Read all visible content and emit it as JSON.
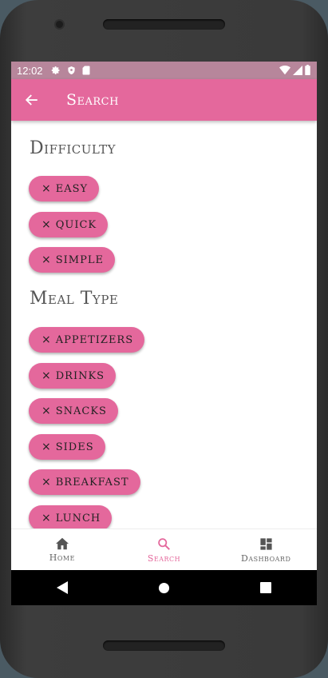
{
  "status": {
    "time": "12:02"
  },
  "appbar": {
    "title": "Search"
  },
  "sections": {
    "difficulty": {
      "title": "Difficulty",
      "chips": [
        "EASY",
        "QUICK",
        "SIMPLE"
      ]
    },
    "meal_type": {
      "title": "Meal Type",
      "chips": [
        "APPETIZERS",
        "DRINKS",
        "SNACKS",
        "SIDES",
        "BREAKFAST",
        "LUNCH"
      ]
    }
  },
  "chip_remove_glyph": "×",
  "bottom_nav": {
    "home": "Home",
    "search": "Search",
    "dashboard": "Dashboard"
  },
  "colors": {
    "accent": "#e4689c",
    "status_bar": "#b7869b"
  },
  "icons": [
    "settings-icon",
    "shield-icon",
    "sd-card-icon",
    "wifi-icon",
    "signal-icon",
    "battery-icon",
    "back-arrow-icon",
    "home-icon",
    "search-icon",
    "dashboard-icon",
    "nav-back-icon",
    "nav-home-icon",
    "nav-recents-icon"
  ]
}
